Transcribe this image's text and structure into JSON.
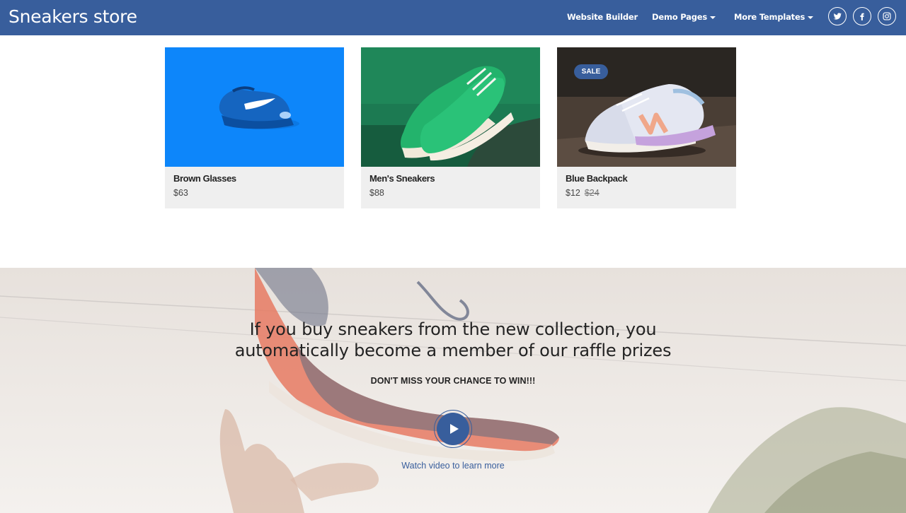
{
  "navbar": {
    "brand": "Sneakers store",
    "links": [
      {
        "label": "Website Builder"
      },
      {
        "label": "Demo Pages"
      },
      {
        "label": "More Templates"
      }
    ],
    "social": [
      "twitter-icon",
      "facebook-icon",
      "instagram-icon"
    ],
    "bg_color": "#385e9c"
  },
  "products": [
    {
      "name": "Brown Glasses",
      "price": "$63",
      "image": "blue-sneaker-photo"
    },
    {
      "name": "Men's Sneakers",
      "price": "$88",
      "image": "green-sneakers-photo"
    },
    {
      "name": "Blue Backpack",
      "price": "$12",
      "old_price": "$24",
      "badge": "SALE",
      "image": "new-balance-sneakers-photo"
    }
  ],
  "hero": {
    "title_line1": "If you buy sneakers from the new collection, you",
    "title_line2": "automatically become a member of our raffle prizes",
    "subtitle": "DON'T MISS YOUR CHANCE TO WIN!!!",
    "video_link": "Watch video to learn more",
    "play_icon": "play-icon"
  }
}
